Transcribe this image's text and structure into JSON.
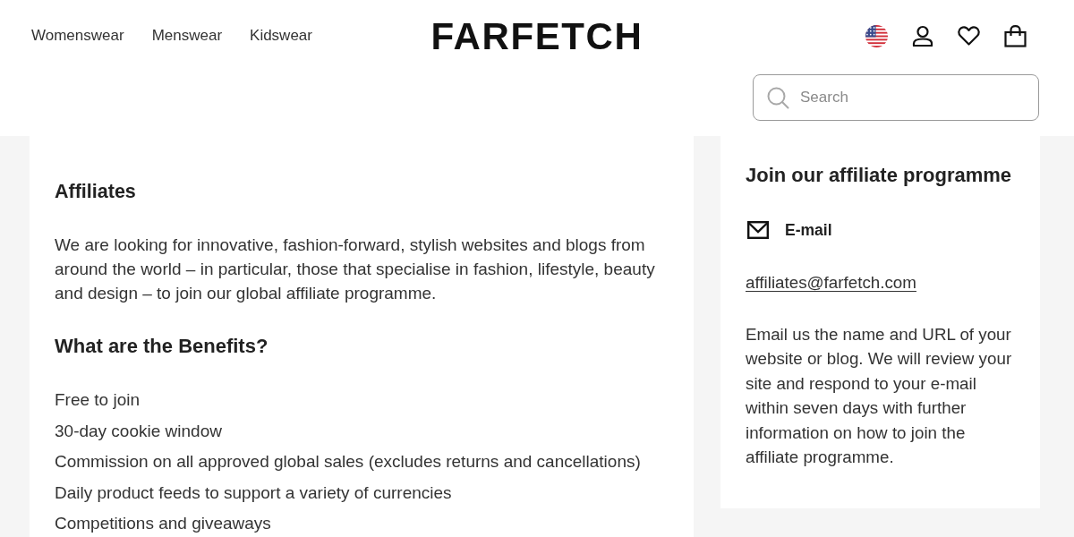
{
  "header": {
    "nav_links": [
      {
        "label": "Womenswear"
      },
      {
        "label": "Menswear"
      },
      {
        "label": "Kidswear"
      }
    ],
    "logo": "FARFETCH",
    "search": {
      "placeholder": "Search"
    }
  },
  "main": {
    "title": "Affiliates",
    "intro": "We are looking for innovative, fashion-forward, stylish websites and blogs from around the world – in particular, those that specialise in fashion, lifestyle, beauty and design – to join our global affiliate programme.",
    "benefits_title": "What are the Benefits?",
    "benefits": [
      "Free to join",
      "30-day cookie window",
      "Commission on all approved global sales (excludes returns and cancellations)",
      "Daily product feeds to support a variety of currencies",
      "Competitions and giveaways"
    ]
  },
  "sidebar": {
    "title": "Join our affiliate programme",
    "contact_label": "E-mail",
    "email": "affiliates@farfetch.com",
    "note": "Email us the name and URL of your website or blog. We will review your site and respond to your e-mail within seven days with further information on how to join the affiliate programme."
  }
}
